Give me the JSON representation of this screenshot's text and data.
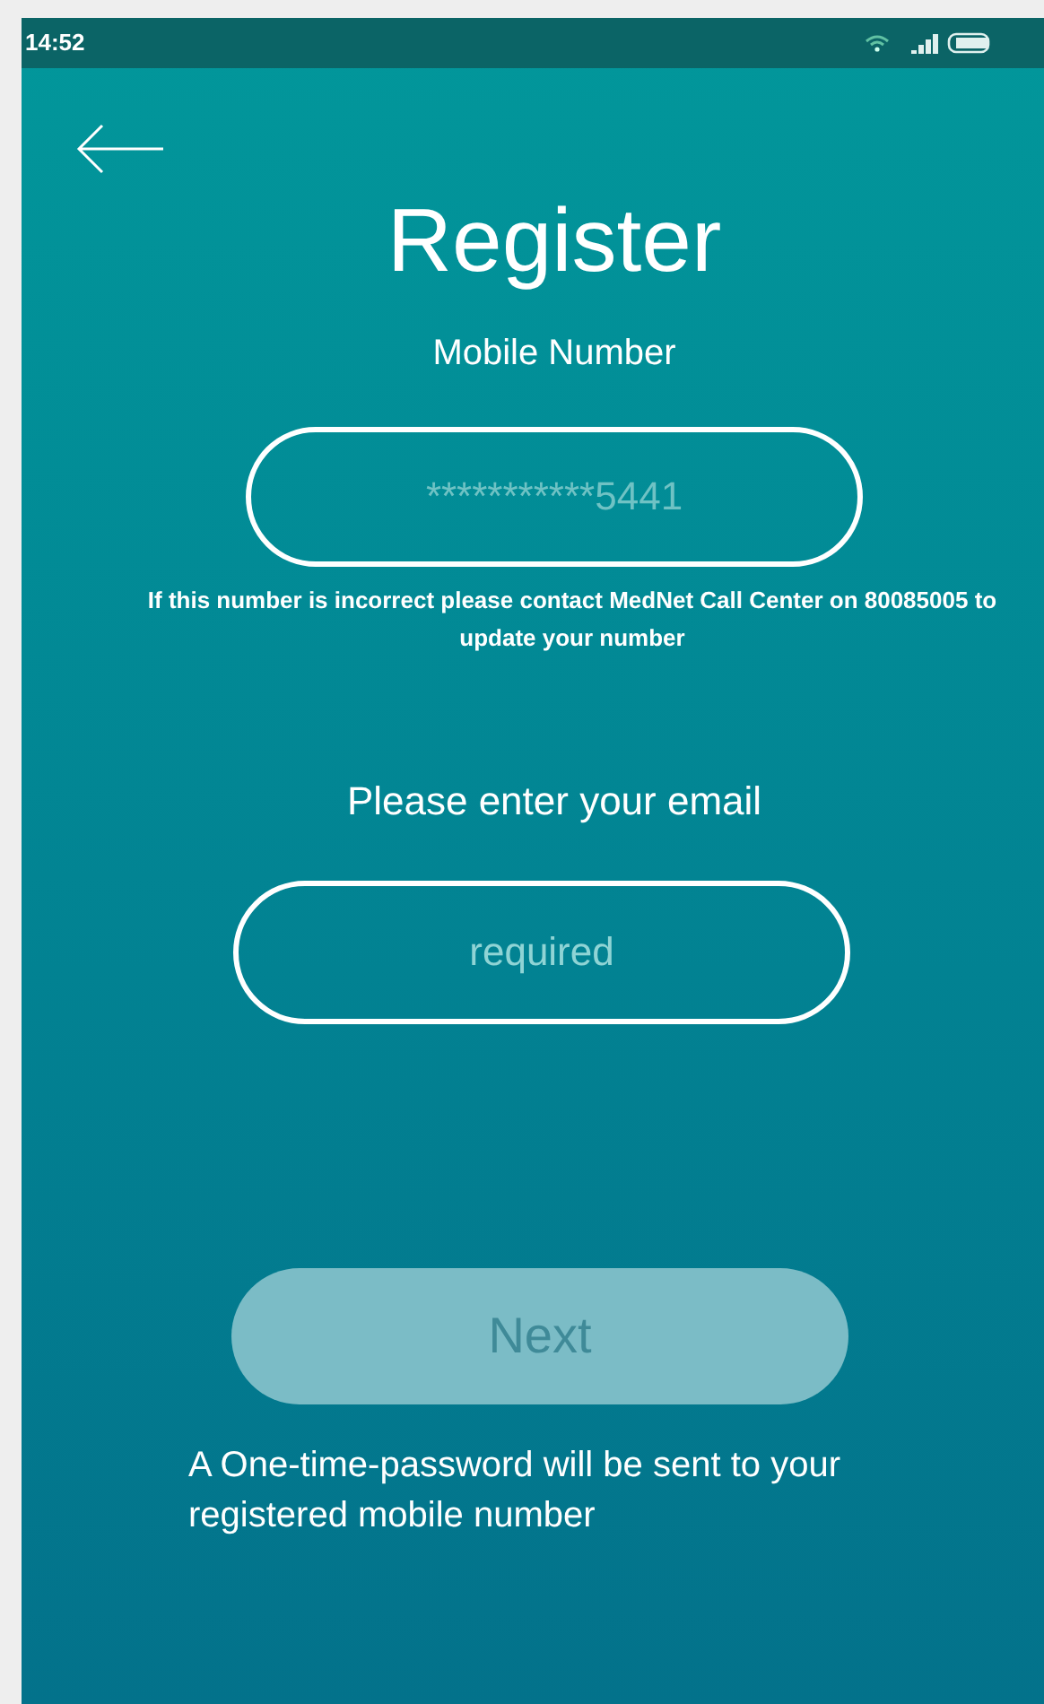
{
  "status_bar": {
    "time": "14:52"
  },
  "title": "Register",
  "mobile": {
    "label": "Mobile Number",
    "value": "***********5441",
    "note": "If this number is incorrect please contact MedNet Call Center on 80085005 to update your number"
  },
  "email": {
    "label": "Please enter your email",
    "placeholder": "required"
  },
  "next_button": {
    "label": "Next",
    "disabled": true
  },
  "footer_note": "A One-time-password will be sent to your registered mobile number"
}
